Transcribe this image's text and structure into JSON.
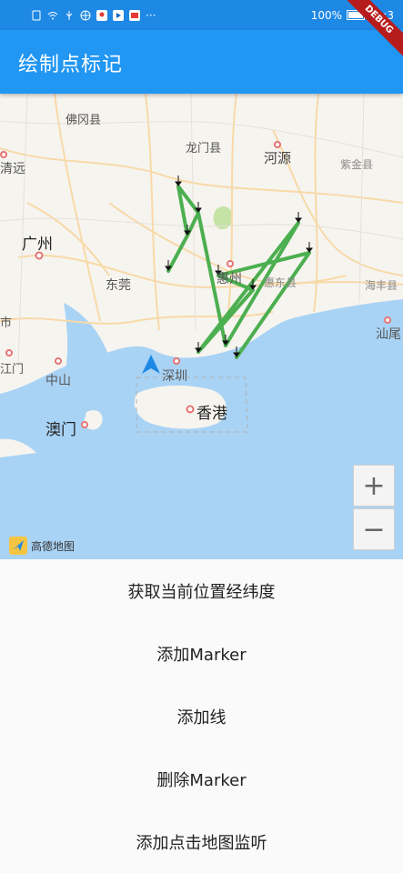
{
  "status_bar": {
    "battery": "100%",
    "time": "11:3",
    "more": "···"
  },
  "app_bar": {
    "title": "绘制点标记",
    "debug": "DEBUG"
  },
  "map": {
    "places": {
      "foshan_gang": "佛冈县",
      "longmen": "龙门县",
      "heyuan": "河源",
      "zijin": "紫金县",
      "qingyuan": "清远",
      "guangzhou": "广州",
      "dongguan": "东莞",
      "huizhou": "惠州",
      "huidong": "惠东县",
      "haifeng": "海丰县",
      "shanwei": "汕尾",
      "jiangmen": "江门",
      "zhongshan": "中山",
      "shenzhen": "深圳",
      "hongkong": "香港",
      "macau": "澳门",
      "shi": "市"
    },
    "logo_text": "高德地图",
    "zoom_in": "+",
    "zoom_out": "−",
    "line_color": "#4caf50"
  },
  "buttons": [
    {
      "label": "获取当前位置经纬度"
    },
    {
      "label": "添加Marker"
    },
    {
      "label": "添加线"
    },
    {
      "label": "删除Marker"
    },
    {
      "label": "添加点击地图监听"
    }
  ]
}
